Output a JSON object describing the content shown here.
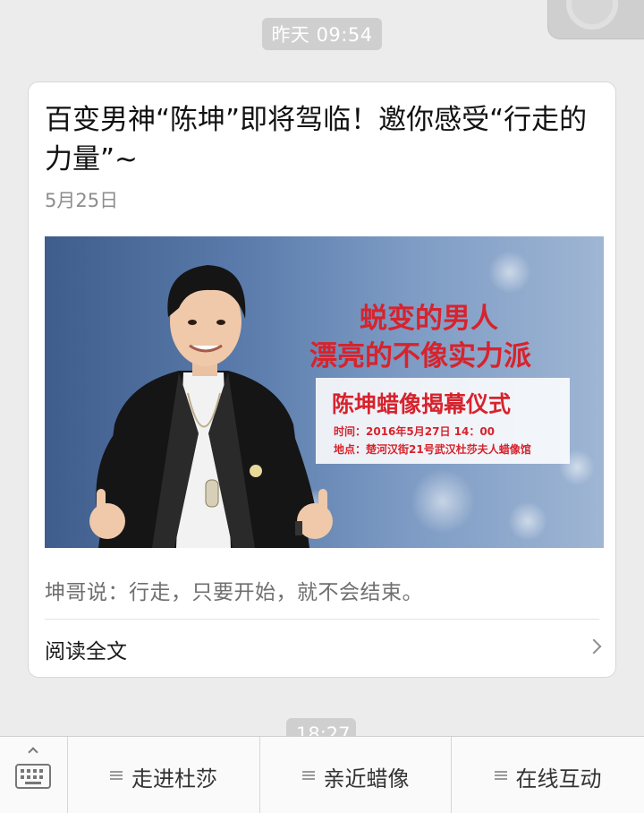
{
  "timestamps": {
    "top": "昨天 09:54",
    "next": "18:27"
  },
  "article": {
    "title": "百变男神“陈坤”即将驾临！邀你感受“行走的力量”~",
    "date": "5月25日",
    "digest": "坤哥说：行走，只要开始，就不会结束。",
    "read_more": "阅读全文",
    "cover": {
      "headline1": "蜕变的男人",
      "headline2": "漂亮的不像实力派",
      "panel_title": "陈坤蜡像揭幕仪式",
      "time_text": "时间：2016年5月27日 14：00",
      "place_text": "地点：楚河汉街21号武汉杜莎夫人蜡像馆",
      "accent_color": "#d7232d"
    }
  },
  "bottom_menu": {
    "keyboard_icon": "keyboard-icon",
    "items": [
      {
        "label": "走进杜莎",
        "icon": "menu-lines-icon"
      },
      {
        "label": "亲近蜡像",
        "icon": "menu-lines-icon"
      },
      {
        "label": "在线互动",
        "icon": "menu-lines-icon"
      }
    ]
  }
}
